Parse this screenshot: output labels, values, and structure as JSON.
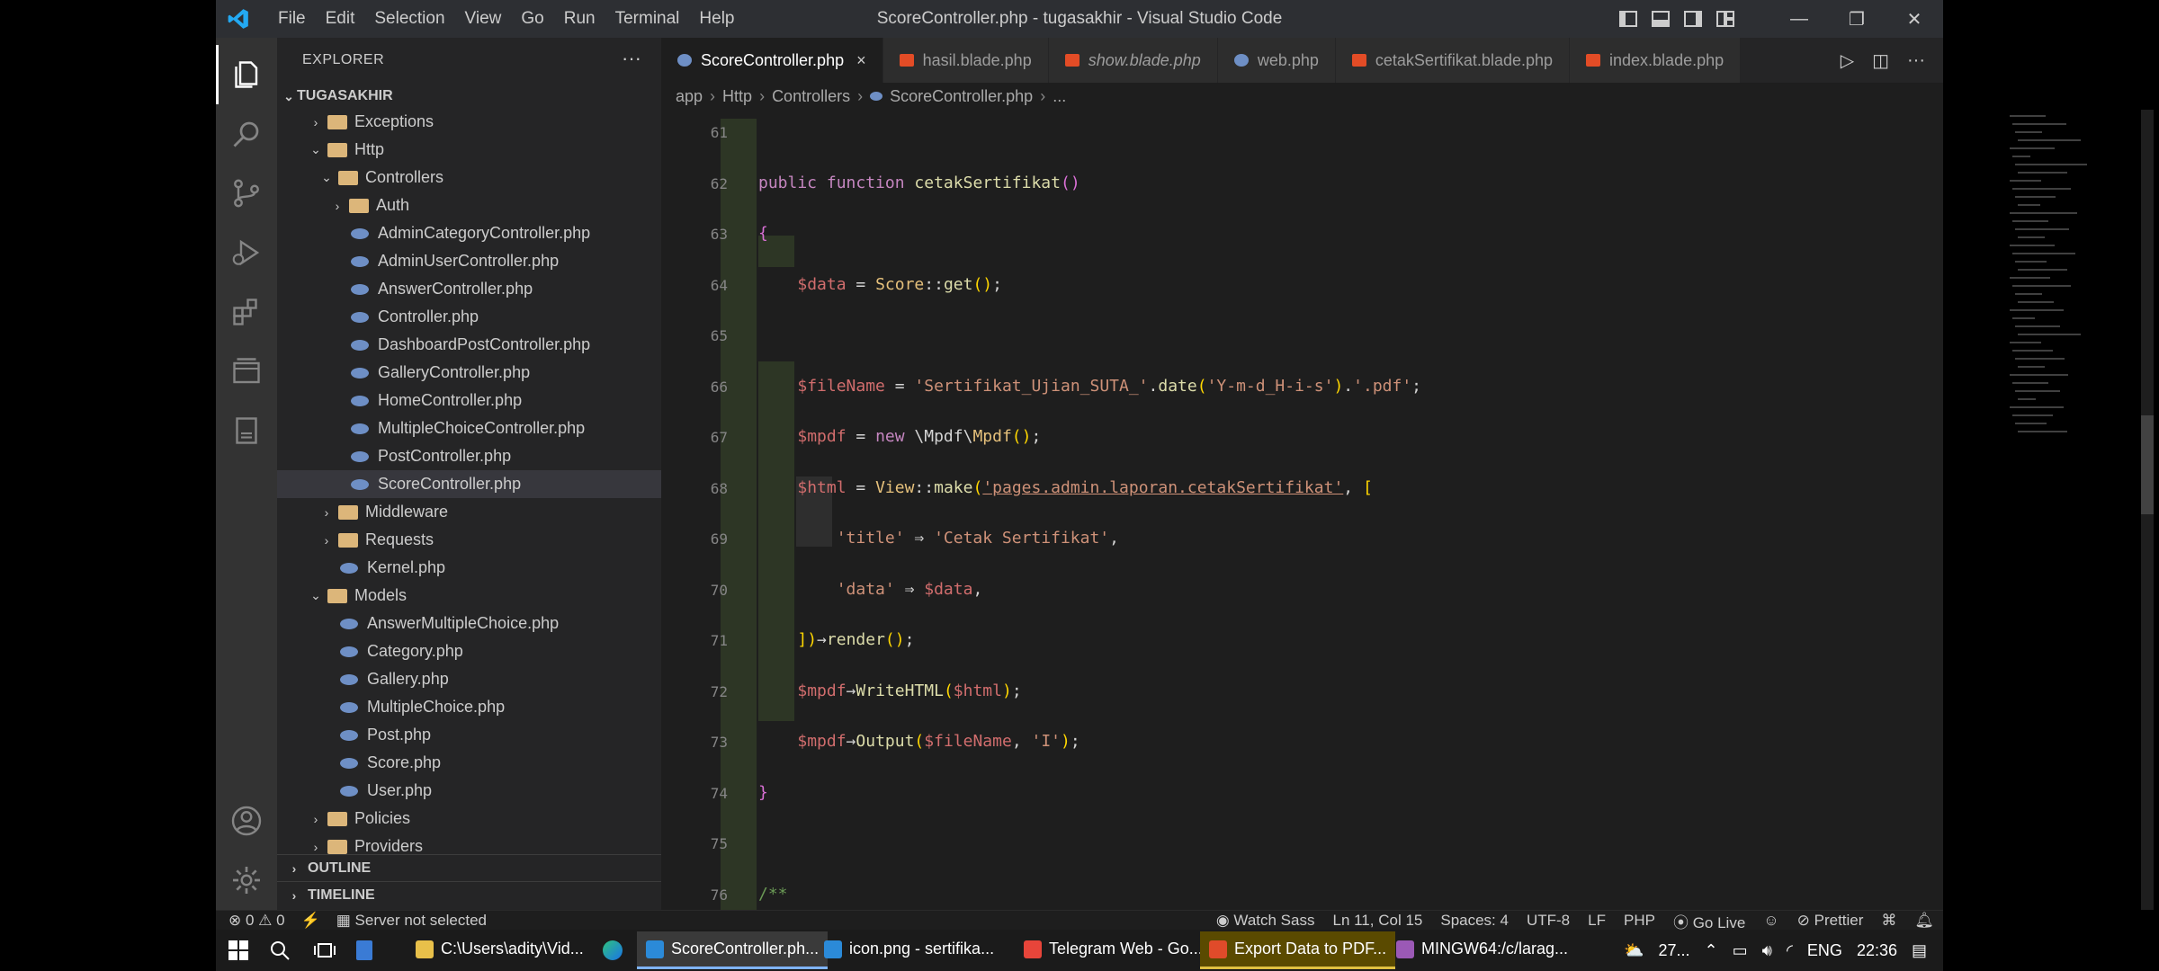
{
  "window": {
    "title": "ScoreController.php - tugasakhir - Visual Studio Code",
    "menus": [
      "File",
      "Edit",
      "Selection",
      "View",
      "Go",
      "Run",
      "Terminal",
      "Help"
    ]
  },
  "sidebar": {
    "header": "EXPLORER",
    "project": "TUGASAKHIR",
    "tree": [
      {
        "label": "Exceptions",
        "type": "folder",
        "depth": 1,
        "expanded": false
      },
      {
        "label": "Http",
        "type": "folder",
        "depth": 1,
        "expanded": true
      },
      {
        "label": "Controllers",
        "type": "folder",
        "depth": 2,
        "expanded": true
      },
      {
        "label": "Auth",
        "type": "folder",
        "depth": 3,
        "expanded": false
      },
      {
        "label": "AdminCategoryController.php",
        "type": "file",
        "depth": 3
      },
      {
        "label": "AdminUserController.php",
        "type": "file",
        "depth": 3
      },
      {
        "label": "AnswerController.php",
        "type": "file",
        "depth": 3
      },
      {
        "label": "Controller.php",
        "type": "file",
        "depth": 3
      },
      {
        "label": "DashboardPostController.php",
        "type": "file",
        "depth": 3
      },
      {
        "label": "GalleryController.php",
        "type": "file",
        "depth": 3
      },
      {
        "label": "HomeController.php",
        "type": "file",
        "depth": 3
      },
      {
        "label": "MultipleChoiceController.php",
        "type": "file",
        "depth": 3
      },
      {
        "label": "PostController.php",
        "type": "file",
        "depth": 3
      },
      {
        "label": "ScoreController.php",
        "type": "file",
        "depth": 3,
        "selected": true
      },
      {
        "label": "Middleware",
        "type": "folder",
        "depth": 2,
        "expanded": false
      },
      {
        "label": "Requests",
        "type": "folder",
        "depth": 2,
        "expanded": false
      },
      {
        "label": "Kernel.php",
        "type": "file",
        "depth": 2
      },
      {
        "label": "Models",
        "type": "folder",
        "depth": 1,
        "expanded": true
      },
      {
        "label": "AnswerMultipleChoice.php",
        "type": "file",
        "depth": 2
      },
      {
        "label": "Category.php",
        "type": "file",
        "depth": 2
      },
      {
        "label": "Gallery.php",
        "type": "file",
        "depth": 2
      },
      {
        "label": "MultipleChoice.php",
        "type": "file",
        "depth": 2
      },
      {
        "label": "Post.php",
        "type": "file",
        "depth": 2
      },
      {
        "label": "Score.php",
        "type": "file",
        "depth": 2
      },
      {
        "label": "User.php",
        "type": "file",
        "depth": 2
      },
      {
        "label": "Policies",
        "type": "folder",
        "depth": 1,
        "expanded": false
      },
      {
        "label": "Providers",
        "type": "folder",
        "depth": 1,
        "expanded": false
      }
    ],
    "outline": "OUTLINE",
    "timeline": "TIMELINE"
  },
  "tabs": [
    {
      "label": "ScoreController.php",
      "active": true,
      "kind": "php",
      "close": "×"
    },
    {
      "label": "hasil.blade.php",
      "kind": "blade"
    },
    {
      "label": "show.blade.php",
      "kind": "blade",
      "italic": true
    },
    {
      "label": "web.php",
      "kind": "php"
    },
    {
      "label": "cetakSertifikat.blade.php",
      "kind": "blade"
    },
    {
      "label": "index.blade.php",
      "kind": "blade"
    }
  ],
  "breadcrumb": [
    "app",
    "Http",
    "Controllers",
    "ScoreController.php",
    "..."
  ],
  "code_lines": [
    {
      "n": "61",
      "html": ""
    },
    {
      "n": "62",
      "html": "<span class='kw'>public</span> <span class='kw'>function</span> <span class='fn'>cetakSertifikat</span><span class='br'>()</span>"
    },
    {
      "n": "63",
      "html": "<span class='br'>{</span>"
    },
    {
      "n": "64",
      "html": "    <span class='var'>$data</span> = <span class='cls'>Score</span>::<span class='fn'>get</span><span class='br2'>()</span>;"
    },
    {
      "n": "65",
      "html": ""
    },
    {
      "n": "66",
      "html": "    <span class='var'>$fileName</span> = <span class='str'>'Sertifikat_Ujian_SUTA_'</span>.<span class='fn'>date</span><span class='br2'>(</span><span class='str'>'Y-m-d_H-i-s'</span><span class='br2'>)</span>.<span class='str'>'.pdf'</span>;"
    },
    {
      "n": "67",
      "html": "    <span class='var'>$mpdf</span> = <span class='kw'>new</span> \\Mpdf\\<span class='cls'>Mpdf</span><span class='br2'>()</span>;"
    },
    {
      "n": "68",
      "html": "    <span class='var'>$html</span> = <span class='cls'>View</span>::<span class='fn'>make</span><span class='br2'>(</span><span class='str ul'>'pages.admin.laporan.cetakSertifikat'</span>, <span class='br2'>[</span>"
    },
    {
      "n": "69",
      "html": "        <span class='str'>'title'</span> ⇒ <span class='str'>'Cetak Sertifikat'</span>,"
    },
    {
      "n": "70",
      "html": "        <span class='str'>'data'</span> ⇒ <span class='var'>$data</span>,"
    },
    {
      "n": "71",
      "html": "    <span class='br2'>])</span>→<span class='fn'>render</span><span class='br2'>()</span>;"
    },
    {
      "n": "72",
      "html": "    <span class='var'>$mpdf</span>→<span class='fn'>WriteHTML</span><span class='br2'>(</span><span class='var'>$html</span><span class='br2'>)</span>;"
    },
    {
      "n": "73",
      "html": "    <span class='var'>$mpdf</span>→<span class='fn'>Output</span><span class='br2'>(</span><span class='var'>$fileName</span>, <span class='str'>'I'</span><span class='br2'>)</span>;"
    },
    {
      "n": "74",
      "html": "<span class='br'>}</span>"
    },
    {
      "n": "75",
      "html": ""
    },
    {
      "n": "76",
      "html": "<span class='cm'>/**</span>"
    }
  ],
  "statusbar": {
    "errors": "⊗ 0 ⚠ 0",
    "server": "Server not selected",
    "watch_sass": "Watch Sass",
    "position": "Ln 11, Col 15",
    "spaces": "Spaces: 4",
    "encoding": "UTF-8",
    "eol": "LF",
    "language": "PHP",
    "golive": "Go Live",
    "prettier": "Prettier"
  },
  "taskbar": {
    "apps": [
      {
        "label": "C:\\Users\\adity\\Vid...",
        "color": "#e8c04a"
      },
      {
        "label": "ScoreController.ph...",
        "color": "#2b8ad8",
        "active": true
      },
      {
        "label": "icon.png - sertifika...",
        "color": "#2b8ad8"
      },
      {
        "label": "Telegram Web - Go...",
        "color": "#e7453a"
      },
      {
        "label": "Export Data to PDF...",
        "color": "#e04b2a",
        "highlight": true
      },
      {
        "label": "MINGW64:/c/larag...",
        "color": "#9b59b6"
      }
    ],
    "temperature": "27...",
    "language": "ENG",
    "time": "22:36"
  },
  "colors": {
    "accent": "#007acc",
    "background": "#1e1e1e",
    "sidebar": "#252526"
  }
}
